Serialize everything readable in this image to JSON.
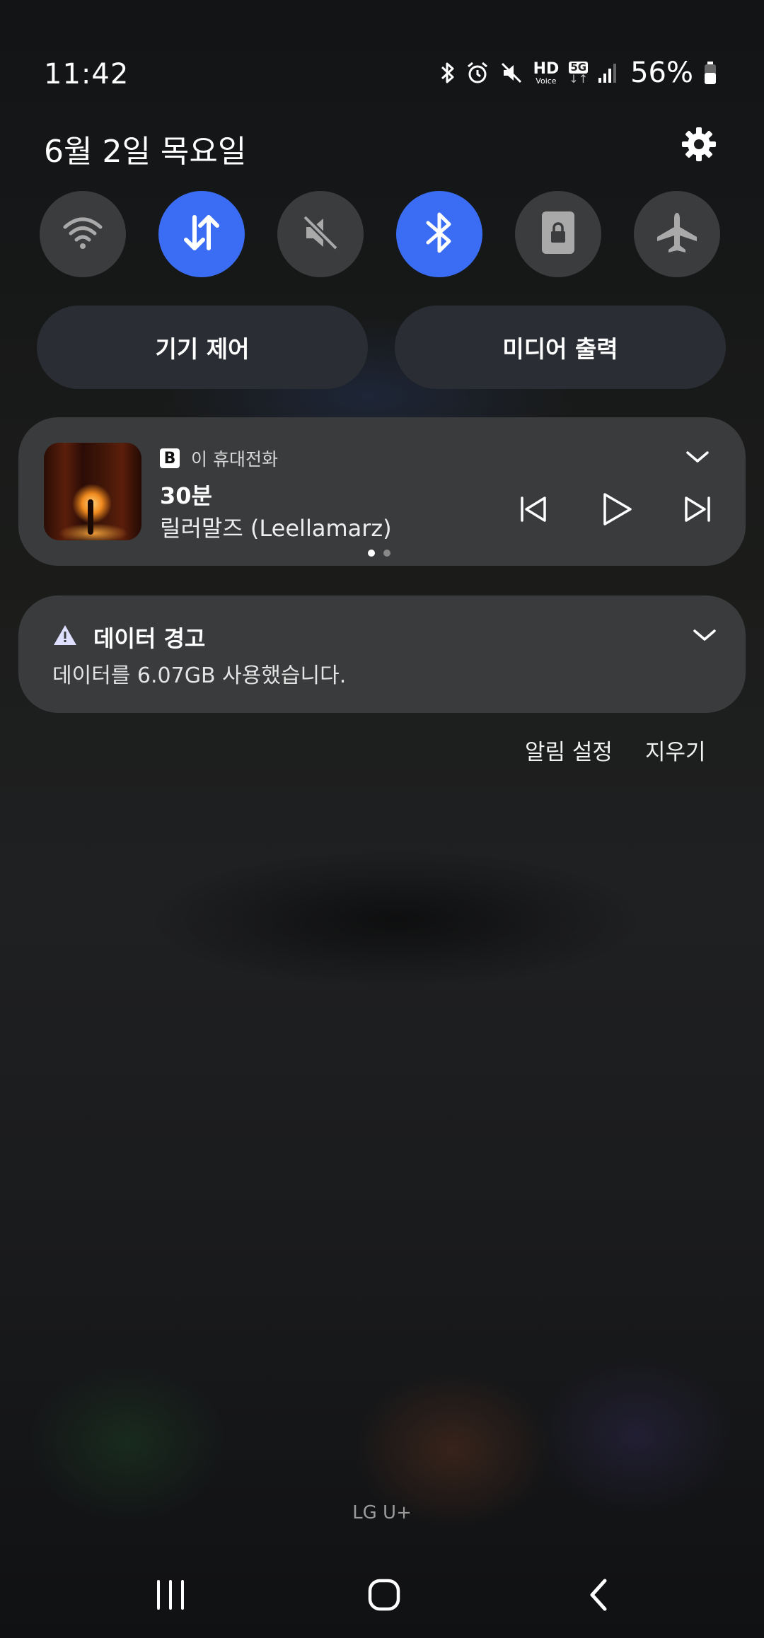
{
  "status_bar": {
    "time": "11:42",
    "hd_label": "HD",
    "voice_label": "Voice",
    "net_label": "5G",
    "net_arrows": "↓↑",
    "battery_percent": "56%",
    "icons": [
      "bluetooth-icon",
      "alarm-icon",
      "mute-icon",
      "hd-voice-icon",
      "5g-icon",
      "signal-icon",
      "battery-icon"
    ]
  },
  "header": {
    "date": "6월 2일 목요일",
    "settings_icon": "gear-icon"
  },
  "quick_toggles": [
    {
      "name": "wifi",
      "icon": "wifi-icon",
      "active": false
    },
    {
      "name": "mobile-data",
      "icon": "data-arrows-icon",
      "active": true
    },
    {
      "name": "sound",
      "icon": "mute-icon",
      "active": false
    },
    {
      "name": "bluetooth",
      "icon": "bluetooth-icon",
      "active": true
    },
    {
      "name": "rotation-lock",
      "icon": "lock-icon",
      "active": false
    },
    {
      "name": "airplane",
      "icon": "airplane-icon",
      "active": false
    }
  ],
  "buttons": {
    "device_control": "기기 제어",
    "media_output": "미디어 출력"
  },
  "media": {
    "source_icon": "B",
    "source": "이 휴대전화",
    "title": "30분",
    "artist": "릴러말즈 (Leellamarz)",
    "page_count": 2,
    "current_page": 1
  },
  "data_warning": {
    "title": "데이터 경고",
    "body": "데이터를 6.07GB 사용했습니다."
  },
  "actions": {
    "notification_settings": "알림 설정",
    "clear": "지우기"
  },
  "carrier": "LG U+",
  "colors": {
    "accent": "#3a6cf4",
    "toggle_off": "#3b3c3e",
    "card": "#3a3b3d",
    "pill": "#2a2d33"
  }
}
